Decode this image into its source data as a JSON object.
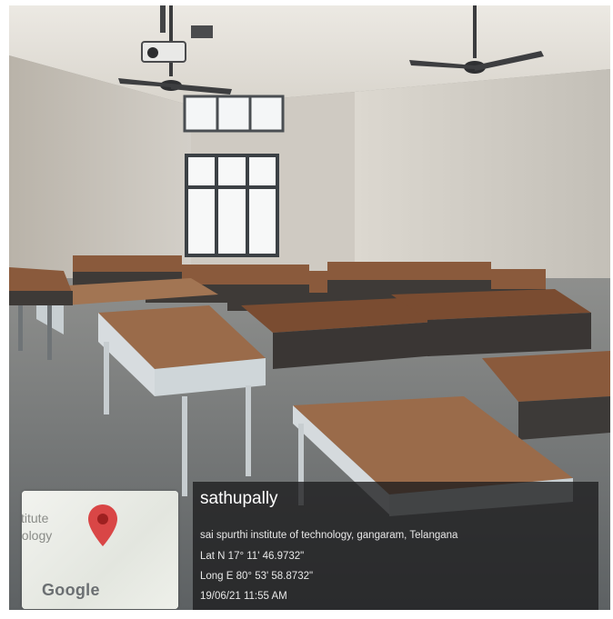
{
  "photo": {
    "subject": "classroom",
    "colors": {
      "wall": "#c9c6bf",
      "desk_top": "#8a5a3c",
      "desk_frame": "#b8c2c6",
      "floor": "#6f7275"
    }
  },
  "map_card": {
    "label_line1": "stitute",
    "label_line2": "nology",
    "brand": "Google",
    "pin_icon": "map-pin-icon",
    "pin_color": "#d94646"
  },
  "geotag": {
    "city": "sathupally",
    "address": "sai spurthi institute of technology, gangaram, Telangana",
    "latitude": "Lat N 17° 11' 46.9732\"",
    "longitude": "Long E 80° 53' 58.8732\"",
    "datetime": "19/06/21 11:55 AM"
  }
}
